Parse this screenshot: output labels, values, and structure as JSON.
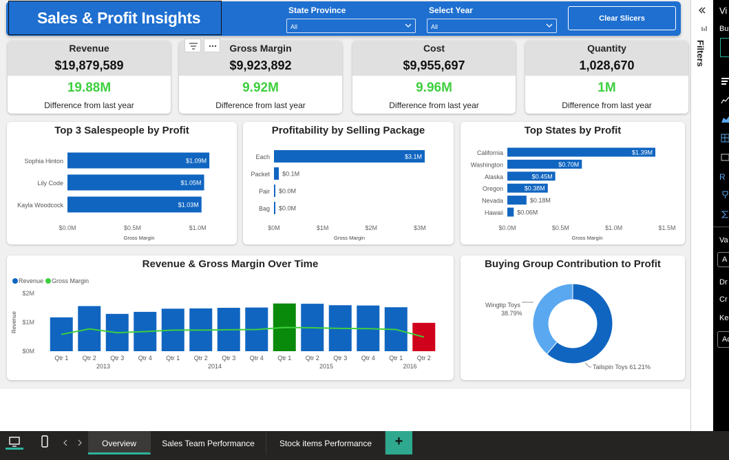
{
  "header": {
    "title": "Sales & Profit Insights",
    "slicers": [
      {
        "label": "State Province",
        "value": "All"
      },
      {
        "label": "Select Year",
        "value": "All"
      }
    ],
    "clear_button": "Clear Slicers"
  },
  "kpis": [
    {
      "name": "Revenue",
      "value": "$19,879,589",
      "diff": "19.88M",
      "sub": "Difference from last year"
    },
    {
      "name": "Gross Margin",
      "value": "$9,923,892",
      "diff": "9.92M",
      "sub": "Difference from last year"
    },
    {
      "name": "Cost",
      "value": "$9,955,697",
      "diff": "9.96M",
      "sub": "Difference from last year"
    },
    {
      "name": "Quantity",
      "value": "1,028,670",
      "diff": "1M",
      "sub": "Difference from last year"
    }
  ],
  "visual_header_icons": [
    "filter-icon",
    "more-options-icon"
  ],
  "chart_data": [
    {
      "type": "bar",
      "title": "Top 3 Salespeople by Profit",
      "categories": [
        "Sophia Hinton",
        "Lily Code",
        "Kayla Woodcock"
      ],
      "values": [
        1.09,
        1.05,
        1.03
      ],
      "value_labels": [
        "$1.09M",
        "$1.05M",
        "$1.03M"
      ],
      "xlabel": "Gross Margin",
      "xticks": [
        "$0.0M",
        "$0.5M",
        "$1.0M"
      ],
      "xlim": [
        0,
        1.1
      ],
      "color": "#1065c0"
    },
    {
      "type": "bar",
      "title": "Profitability by Selling Package",
      "categories": [
        "Each",
        "Packet",
        "Pair",
        "Bag"
      ],
      "values": [
        3.1,
        0.1,
        0.01,
        0.01
      ],
      "value_labels": [
        "$3.1M",
        "$0.1M",
        "$0.0M",
        "$0.0M"
      ],
      "xlabel": "Gross Margin",
      "xticks": [
        "$0M",
        "$1M",
        "$2M",
        "$3M"
      ],
      "xlim": [
        0,
        3.1
      ],
      "color": "#1065c0"
    },
    {
      "type": "bar",
      "title": "Top States by Profit",
      "categories": [
        "California",
        "Washington",
        "Alaska",
        "Oregon",
        "Nevada",
        "Hawaii"
      ],
      "values": [
        1.39,
        0.7,
        0.45,
        0.38,
        0.18,
        0.06
      ],
      "value_labels": [
        "$1.39M",
        "$0.70M",
        "$0.45M",
        "$0.38M",
        "$0.18M",
        "$0.06M"
      ],
      "xlabel": "Gross Margin",
      "xticks": [
        "$0.0M",
        "$0.5M",
        "$1.0M",
        "$1.5M"
      ],
      "xlim": [
        0,
        1.5
      ],
      "color": "#1065c0"
    },
    {
      "type": "bar",
      "title": "Revenue & Gross Margin Over Time",
      "legend": [
        {
          "name": "Revenue",
          "color": "#1065c0"
        },
        {
          "name": "Gross Margin",
          "color": "#3ecf3e"
        }
      ],
      "legend_position": "top-left",
      "ylabel": "Revenue",
      "yticks": [
        "$0M",
        "$1M",
        "$2M"
      ],
      "ylim": [
        0,
        2
      ],
      "categories": [
        "Qtr 1",
        "Qtr 2",
        "Qtr 3",
        "Qtr 4",
        "Qtr 1",
        "Qtr 2",
        "Qtr 3",
        "Qtr 4",
        "Qtr 1",
        "Qtr 2",
        "Qtr 3",
        "Qtr 4",
        "Qtr 1",
        "Qtr 2"
      ],
      "years": [
        {
          "label": "2013",
          "start": 0,
          "end": 3
        },
        {
          "label": "2014",
          "start": 4,
          "end": 7
        },
        {
          "label": "2015",
          "start": 8,
          "end": 11
        },
        {
          "label": "2016",
          "start": 12,
          "end": 13
        }
      ],
      "series": [
        {
          "name": "Revenue",
          "values": [
            1.17,
            1.56,
            1.29,
            1.36,
            1.47,
            1.48,
            1.5,
            1.51,
            1.65,
            1.64,
            1.59,
            1.58,
            1.52,
            0.98
          ]
        },
        {
          "name": "Gross Margin",
          "values": [
            0.58,
            0.77,
            0.64,
            0.68,
            0.73,
            0.73,
            0.74,
            0.75,
            0.82,
            0.81,
            0.79,
            0.78,
            0.75,
            0.49
          ]
        }
      ],
      "bar_colors": [
        "#1065c0",
        "#1065c0",
        "#1065c0",
        "#1065c0",
        "#1065c0",
        "#1065c0",
        "#1065c0",
        "#1065c0",
        "#0a8a0a",
        "#1065c0",
        "#1065c0",
        "#1065c0",
        "#1065c0",
        "#d0021b"
      ]
    },
    {
      "type": "pie",
      "title": "Buying Group Contribution to Profit",
      "labels": [
        "Tailspin Toys",
        "Wingtip Toys"
      ],
      "values": [
        61.21,
        38.79
      ],
      "value_labels": [
        "Tailspin Toys 61.21%",
        "Wingtip Toys"
      ],
      "wingtip_pct": "38.79%",
      "colors": [
        "#1065c0",
        "#5aa8f0"
      ]
    }
  ],
  "right_pane": {
    "filters_label": "Filters",
    "texts": [
      "Vi",
      "Bu",
      "R",
      "Va",
      "A",
      "Dr",
      "Cr",
      "Ke",
      "Ad"
    ]
  },
  "bottom_bar": {
    "tabs": [
      "Overview",
      "Sales Team Performance",
      "Stock items Performance"
    ],
    "add_label": "+"
  }
}
